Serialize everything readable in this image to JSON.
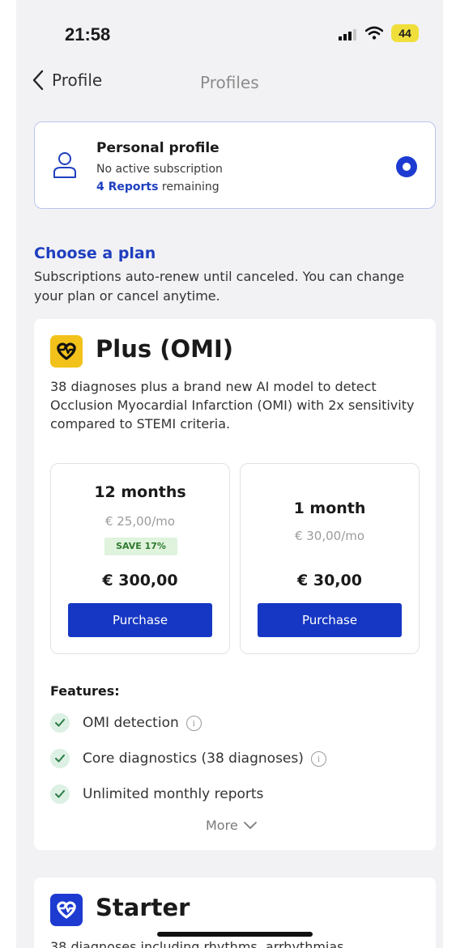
{
  "status_bar": {
    "time": "21:58",
    "battery": "44"
  },
  "nav": {
    "back_label": "Profile",
    "title": "Profiles"
  },
  "profile": {
    "title": "Personal profile",
    "subscription": "No active subscription",
    "reports_count": "4 Reports",
    "reports_suffix": " remaining"
  },
  "choose": {
    "title": "Choose a plan",
    "description": "Subscriptions auto-renew until canceled. You can change your plan or cancel anytime."
  },
  "plan": {
    "name": "Plus (OMI)",
    "icon": "heart-ecg-icon",
    "accent": "#f2c21a",
    "description": "38 diagnoses plus a brand new AI model to detect Occlusion Myocardial Infarction (OMI) with 2x sensitivity compared to STEMI criteria.",
    "options": [
      {
        "duration": "12 months",
        "monthly": "€ 25,00/mo",
        "badge": "SAVE 17%",
        "price": "€ 300,00",
        "button": "Purchase"
      },
      {
        "duration": "1 month",
        "monthly": "€ 30,00/mo",
        "price": "€ 30,00",
        "button": "Purchase"
      }
    ],
    "features_label": "Features:",
    "features": [
      "OMI detection",
      "Core diagnostics (38 diagnoses)",
      "Unlimited monthly reports"
    ],
    "more_label": "More"
  },
  "starter": {
    "name": "Starter",
    "icon": "heart-ecg-icon",
    "accent": "#1d3bd1",
    "description": "38 diagnoses including rhythms, arrhythmias"
  },
  "colors": {
    "primary": "#1637c4",
    "link": "#1f3fbf",
    "background": "#f2f2f5"
  }
}
